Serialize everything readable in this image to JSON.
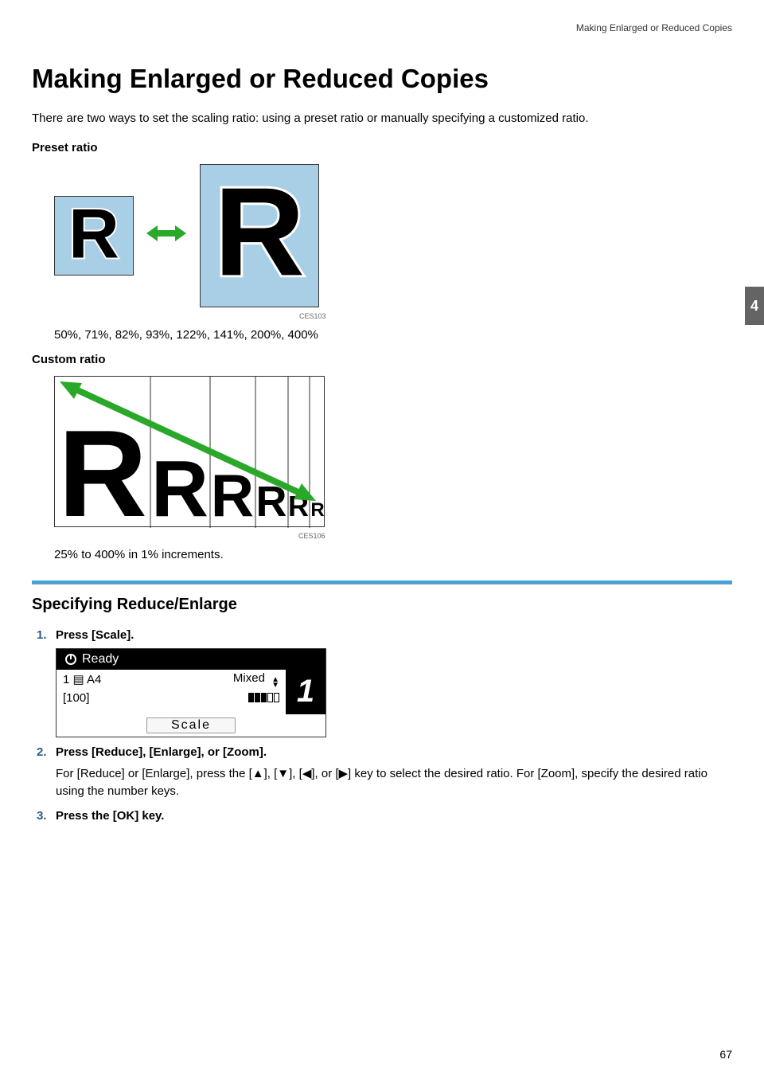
{
  "header": {
    "running_title": "Making Enlarged or Reduced Copies"
  },
  "title": "Making Enlarged or Reduced Copies",
  "intro": "There are two ways to set the scaling ratio: using a preset ratio or manually specifying a customized ratio.",
  "preset": {
    "label": "Preset ratio",
    "figure_code": "CES103",
    "ratios_text": "50%, 71%, 82%, 93%, 122%, 141%, 200%, 400%"
  },
  "custom": {
    "label": "Custom ratio",
    "figure_code": "CES106",
    "range_text": "25% to 400% in 1% increments."
  },
  "section2": {
    "title": "Specifying Reduce/Enlarge",
    "steps": [
      {
        "title": "Press [Scale].",
        "body": ""
      },
      {
        "title": "Press [Reduce], [Enlarge], or [Zoom].",
        "body": "For [Reduce] or [Enlarge], press the [▲], [▼], [◀], or [▶] key to select the desired ratio. For [Zoom], specify the desired ratio using the number keys."
      },
      {
        "title": "Press the [OK] key.",
        "body": ""
      }
    ]
  },
  "lcd": {
    "ready": "Ready",
    "paper_line": "1 ▤ A4",
    "mixed": "Mixed",
    "copies_value": "100",
    "big_number": "1",
    "scale_button": "Scale"
  },
  "side_tab": "4",
  "page_number": "67"
}
